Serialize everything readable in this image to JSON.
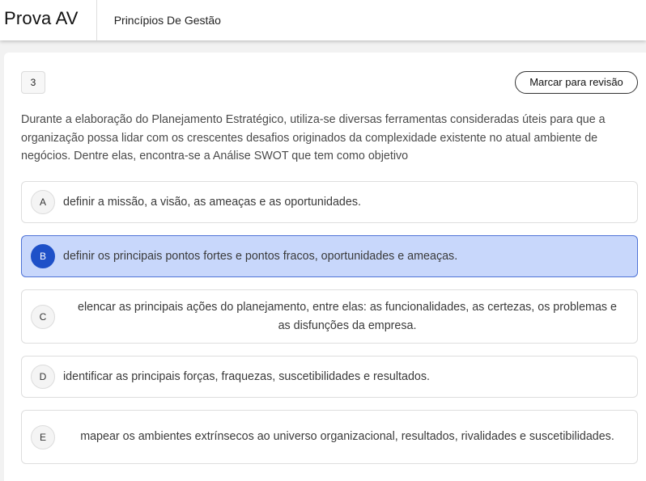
{
  "header": {
    "brand": "Prova AV",
    "course": "Princípios De Gestão"
  },
  "question": {
    "number": "3",
    "review_label": "Marcar para revisão",
    "statement": "Durante a elaboração do Planejamento Estratégico, utiliza-se diversas ferramentas consideradas úteis para que a organização possa lidar com os crescentes desafios originados da complexidade existente no atual ambiente de negócios. Dentre elas, encontra-se a Análise SWOT que tem como objetivo"
  },
  "options": [
    {
      "letter": "A",
      "text": "definir a missão, a visão, as ameaças e as oportunidades.",
      "selected": false
    },
    {
      "letter": "B",
      "text": "definir os principais pontos fortes e pontos fracos, oportunidades e ameaças.",
      "selected": true
    },
    {
      "letter": "C",
      "text": "elencar as principais ações do planejamento, entre elas: as funcionalidades, as certezas, os problemas e as disfunções da empresa.",
      "selected": false
    },
    {
      "letter": "D",
      "text": "identificar as principais forças, fraquezas, suscetibilidades e resultados.",
      "selected": false
    },
    {
      "letter": "E",
      "text": "mapear os ambientes extrínsecos ao universo organizacional, resultados, rivalidades e suscetibilidades.",
      "selected": false
    }
  ],
  "colors": {
    "selected_bg": "#c8d7fb",
    "selected_border": "#4f73d6",
    "selected_letter_bg": "#1e50c8"
  }
}
